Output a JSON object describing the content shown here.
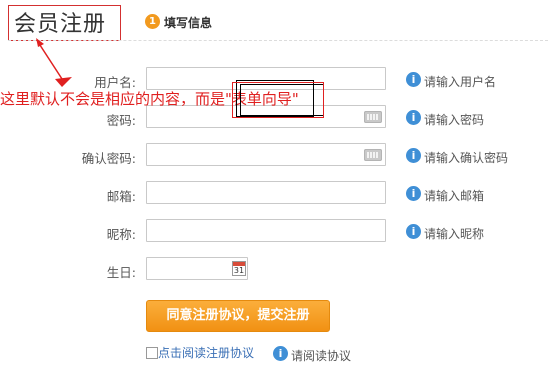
{
  "header": {
    "title": "会员注册",
    "step_number": "1",
    "step_label": "填写信息"
  },
  "form": {
    "rows": [
      {
        "label": "用户名:",
        "hint": "请输入用户名"
      },
      {
        "label": "密码:",
        "hint": "请输入密码"
      },
      {
        "label": "确认密码:",
        "hint": "请输入确认密码"
      },
      {
        "label": "邮箱:",
        "hint": "请输入邮箱"
      },
      {
        "label": "昵称:",
        "hint": "请输入昵称"
      },
      {
        "label": "生日:"
      }
    ],
    "calendar_day": "31",
    "submit_label": "同意注册协议，提交注册",
    "agree_label": "点击阅读注册协议",
    "agree_hint": "请阅读协议"
  },
  "annotation": {
    "text": "这里默认不会是相应的内容，而是\"表单向导\""
  },
  "icons": {
    "info": "i",
    "keyboard": "keyboard-icon",
    "calendar": "calendar-icon"
  },
  "colors": {
    "accent_orange": "#f29a1f",
    "info_blue": "#3f8fd6",
    "annotation_red": "#e02020",
    "link_blue": "#3a6fb5"
  }
}
